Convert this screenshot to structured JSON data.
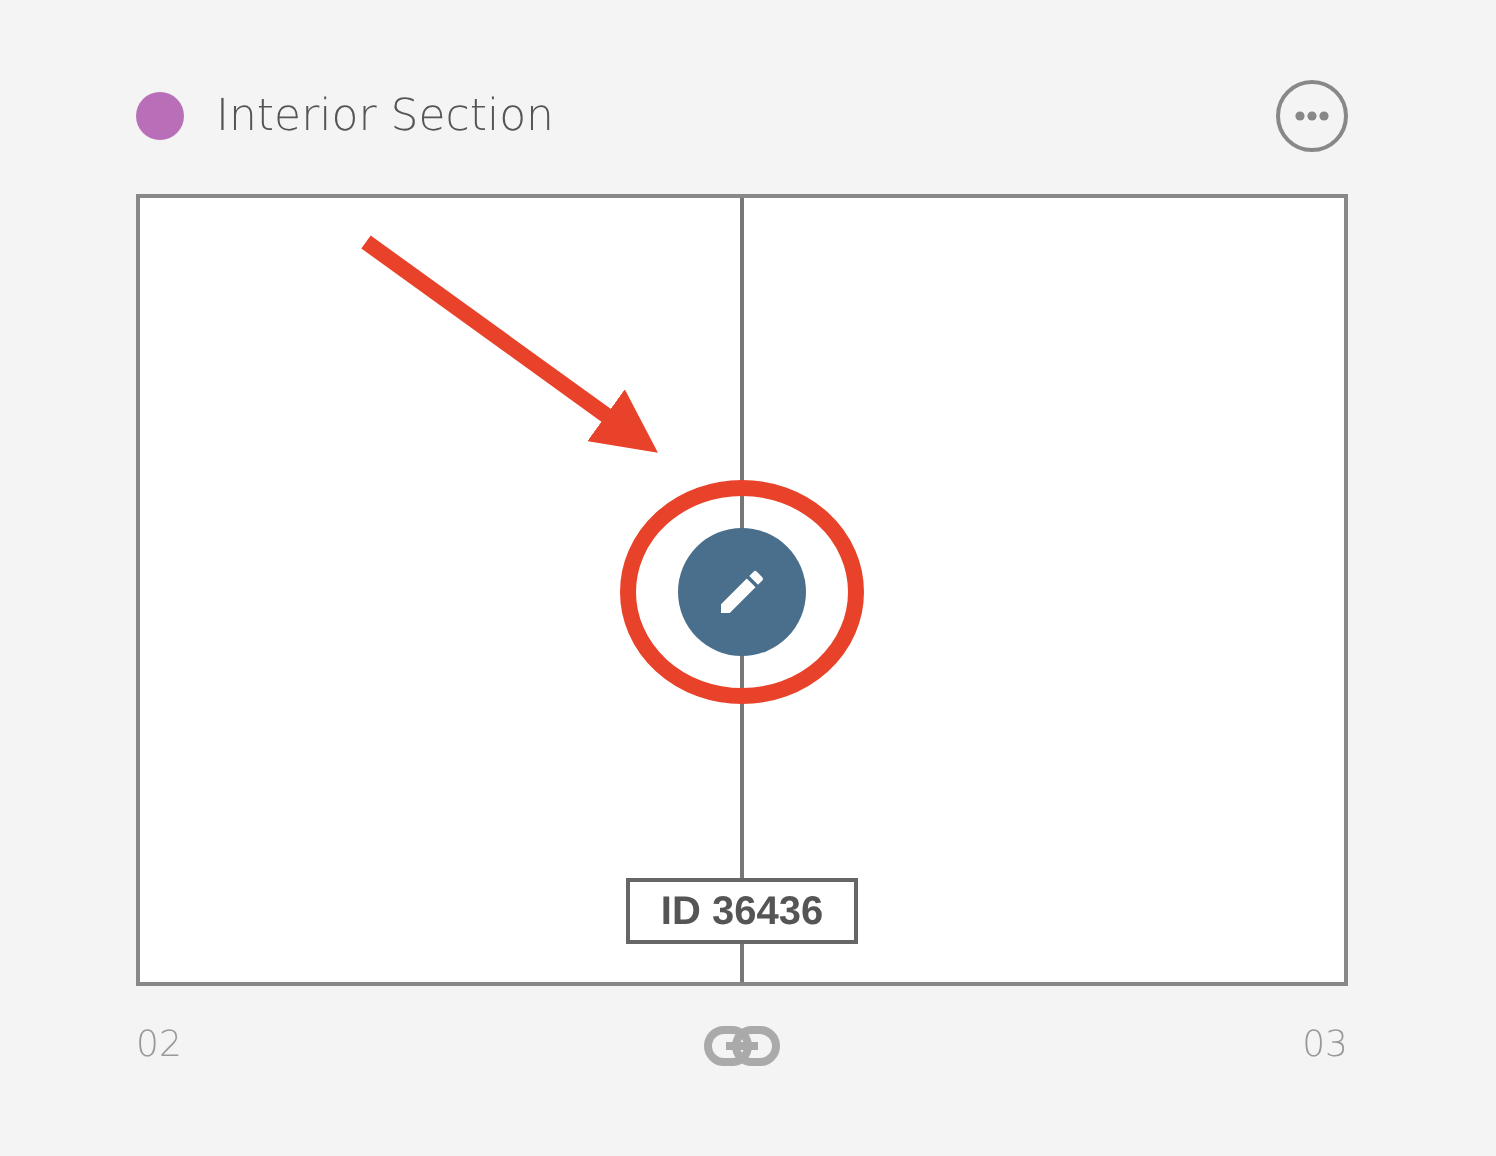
{
  "section": {
    "title": "Interior Section"
  },
  "canvas": {
    "marker_label": "ID 36436"
  },
  "axis": {
    "start": "02",
    "end": "03"
  }
}
